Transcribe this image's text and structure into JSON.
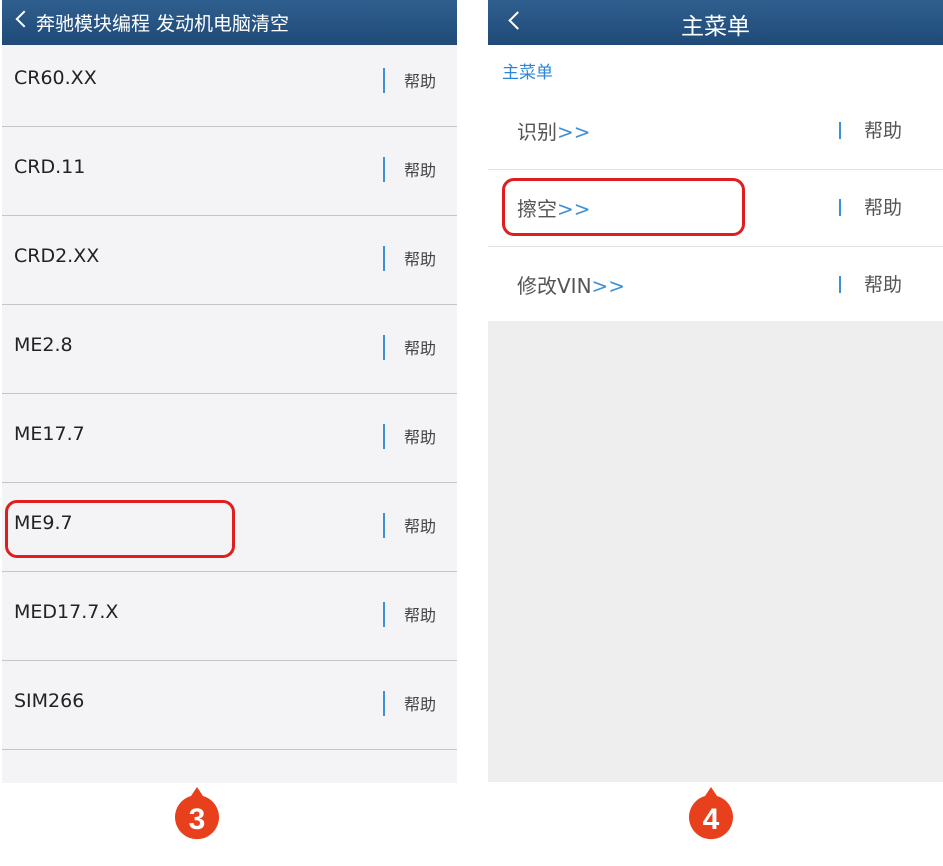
{
  "left_screen": {
    "title": "奔驰模块编程   发动机电脑清空",
    "help_label": "帮助",
    "items": [
      {
        "label": "CR60.XX"
      },
      {
        "label": "CRD.11"
      },
      {
        "label": "CRD2.XX"
      },
      {
        "label": "ME2.8"
      },
      {
        "label": "ME17.7"
      },
      {
        "label": "ME9.7"
      },
      {
        "label": "MED17.7.X"
      },
      {
        "label": "SIM266"
      }
    ],
    "highlighted_item": "ME9.7"
  },
  "right_screen": {
    "title": "主菜单",
    "breadcrumb": "主菜单",
    "help_label": "帮助",
    "items": [
      {
        "label": "识别",
        "arrow": ">>"
      },
      {
        "label": "擦空",
        "arrow": ">>"
      },
      {
        "label": "修改VIN",
        "arrow": ">>"
      }
    ],
    "highlighted_item": "擦空"
  },
  "step_badges": [
    "3",
    "4"
  ],
  "colors": {
    "header": "#24507e",
    "accent": "#3d8fd6",
    "highlight": "#e01e1e",
    "badge": "#e8401c"
  },
  "icons": [
    "back-chevron-icon"
  ]
}
